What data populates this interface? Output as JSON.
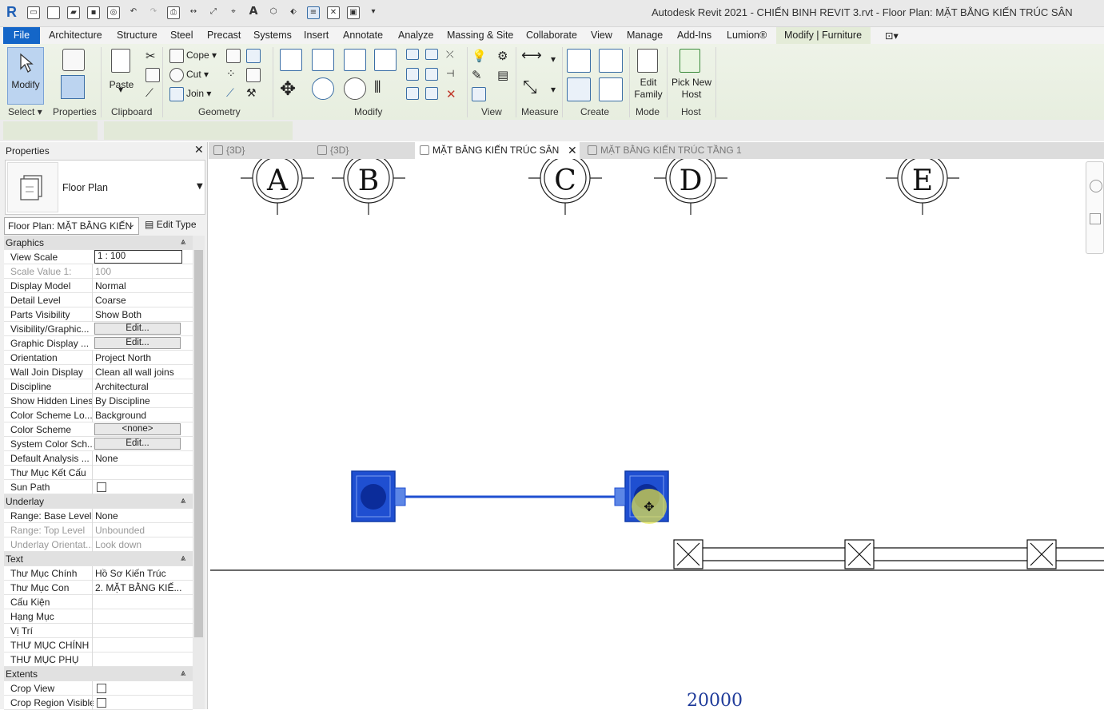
{
  "app": {
    "logo": "R",
    "title": "Autodesk Revit 2021 - CHIẾN BINH REVIT 3.rvt - Floor Plan: MẶT BẰNG KIẾN TRÚC SÂN"
  },
  "menu": {
    "file": "File",
    "items": [
      "Architecture",
      "Structure",
      "Steel",
      "Precast",
      "Systems",
      "Insert",
      "Annotate",
      "Analyze",
      "Massing & Site",
      "Collaborate",
      "View",
      "Manage",
      "Add-Ins",
      "Lumion®",
      "Modify | Furniture"
    ]
  },
  "ribbon": {
    "modify_label": "Modify",
    "properties_label": "Properties",
    "paste_label": "Paste",
    "cope_label": "Cope",
    "cut_label": "Cut",
    "join_label": "Join",
    "edit_family_label": "Edit Family",
    "pick_new_host_label": "Pick New Host",
    "panels": [
      "Select",
      "Properties",
      "Clipboard",
      "Geometry",
      "Modify",
      "View",
      "Measure",
      "Create",
      "Mode",
      "Host"
    ]
  },
  "properties_panel": {
    "title": "Properties",
    "type_name": "Floor Plan",
    "view_selector": "Floor Plan: MẶT BẰNG KIẾN",
    "edit_type": "Edit Type",
    "sections": {
      "graphics": "Graphics",
      "underlay": "Underlay",
      "text": "Text",
      "extents": "Extents"
    },
    "graphics_rows": [
      {
        "k": "View Scale",
        "v": "1 : 100"
      },
      {
        "k": "Scale Value    1:",
        "v": "100"
      },
      {
        "k": "Display Model",
        "v": "Normal"
      },
      {
        "k": "Detail Level",
        "v": "Coarse"
      },
      {
        "k": "Parts Visibility",
        "v": "Show Both"
      },
      {
        "k": "Visibility/Graphic...",
        "v": "Edit..."
      },
      {
        "k": "Graphic Display ...",
        "v": "Edit..."
      },
      {
        "k": "Orientation",
        "v": "Project North"
      },
      {
        "k": "Wall Join Display",
        "v": "Clean all wall joins"
      },
      {
        "k": "Discipline",
        "v": "Architectural"
      },
      {
        "k": "Show Hidden Lines",
        "v": "By Discipline"
      },
      {
        "k": "Color Scheme Lo...",
        "v": "Background"
      },
      {
        "k": "Color Scheme",
        "v": "<none>"
      },
      {
        "k": "System Color Sch...",
        "v": "Edit..."
      },
      {
        "k": "Default Analysis ...",
        "v": "None"
      },
      {
        "k": "Thư Mục Kết Cấu",
        "v": ""
      },
      {
        "k": "Sun Path",
        "v": ""
      }
    ],
    "underlay_rows": [
      {
        "k": "Range: Base Level",
        "v": "None"
      },
      {
        "k": "Range: Top Level",
        "v": "Unbounded"
      },
      {
        "k": "Underlay Orientat...",
        "v": "Look down"
      }
    ],
    "text_rows": [
      {
        "k": "Thư Mục Chính",
        "v": "Hồ Sơ Kiến Trúc"
      },
      {
        "k": "Thư Mục Con",
        "v": "2. MẶT BẰNG KIẾ..."
      },
      {
        "k": "Cấu Kiện",
        "v": ""
      },
      {
        "k": "Hạng Mục",
        "v": ""
      },
      {
        "k": "Vị Trí",
        "v": ""
      },
      {
        "k": "THƯ MỤC CHÍNH",
        "v": ""
      },
      {
        "k": "THƯ MỤC PHỤ",
        "v": ""
      }
    ],
    "extents_rows": [
      {
        "k": "Crop View",
        "v": ""
      },
      {
        "k": "Crop Region Visible",
        "v": ""
      }
    ]
  },
  "view_tabs": [
    "{3D}",
    "{3D}",
    "MẶT BẰNG KIẾN TRÚC SÂN",
    "MẶT BẰNG KIẾN TRÚC TẦNG 1"
  ],
  "drawing": {
    "grid_labels": [
      "A",
      "B",
      "C",
      "D",
      "E"
    ],
    "dimension": "20000",
    "accent": "#1f4fd1"
  }
}
